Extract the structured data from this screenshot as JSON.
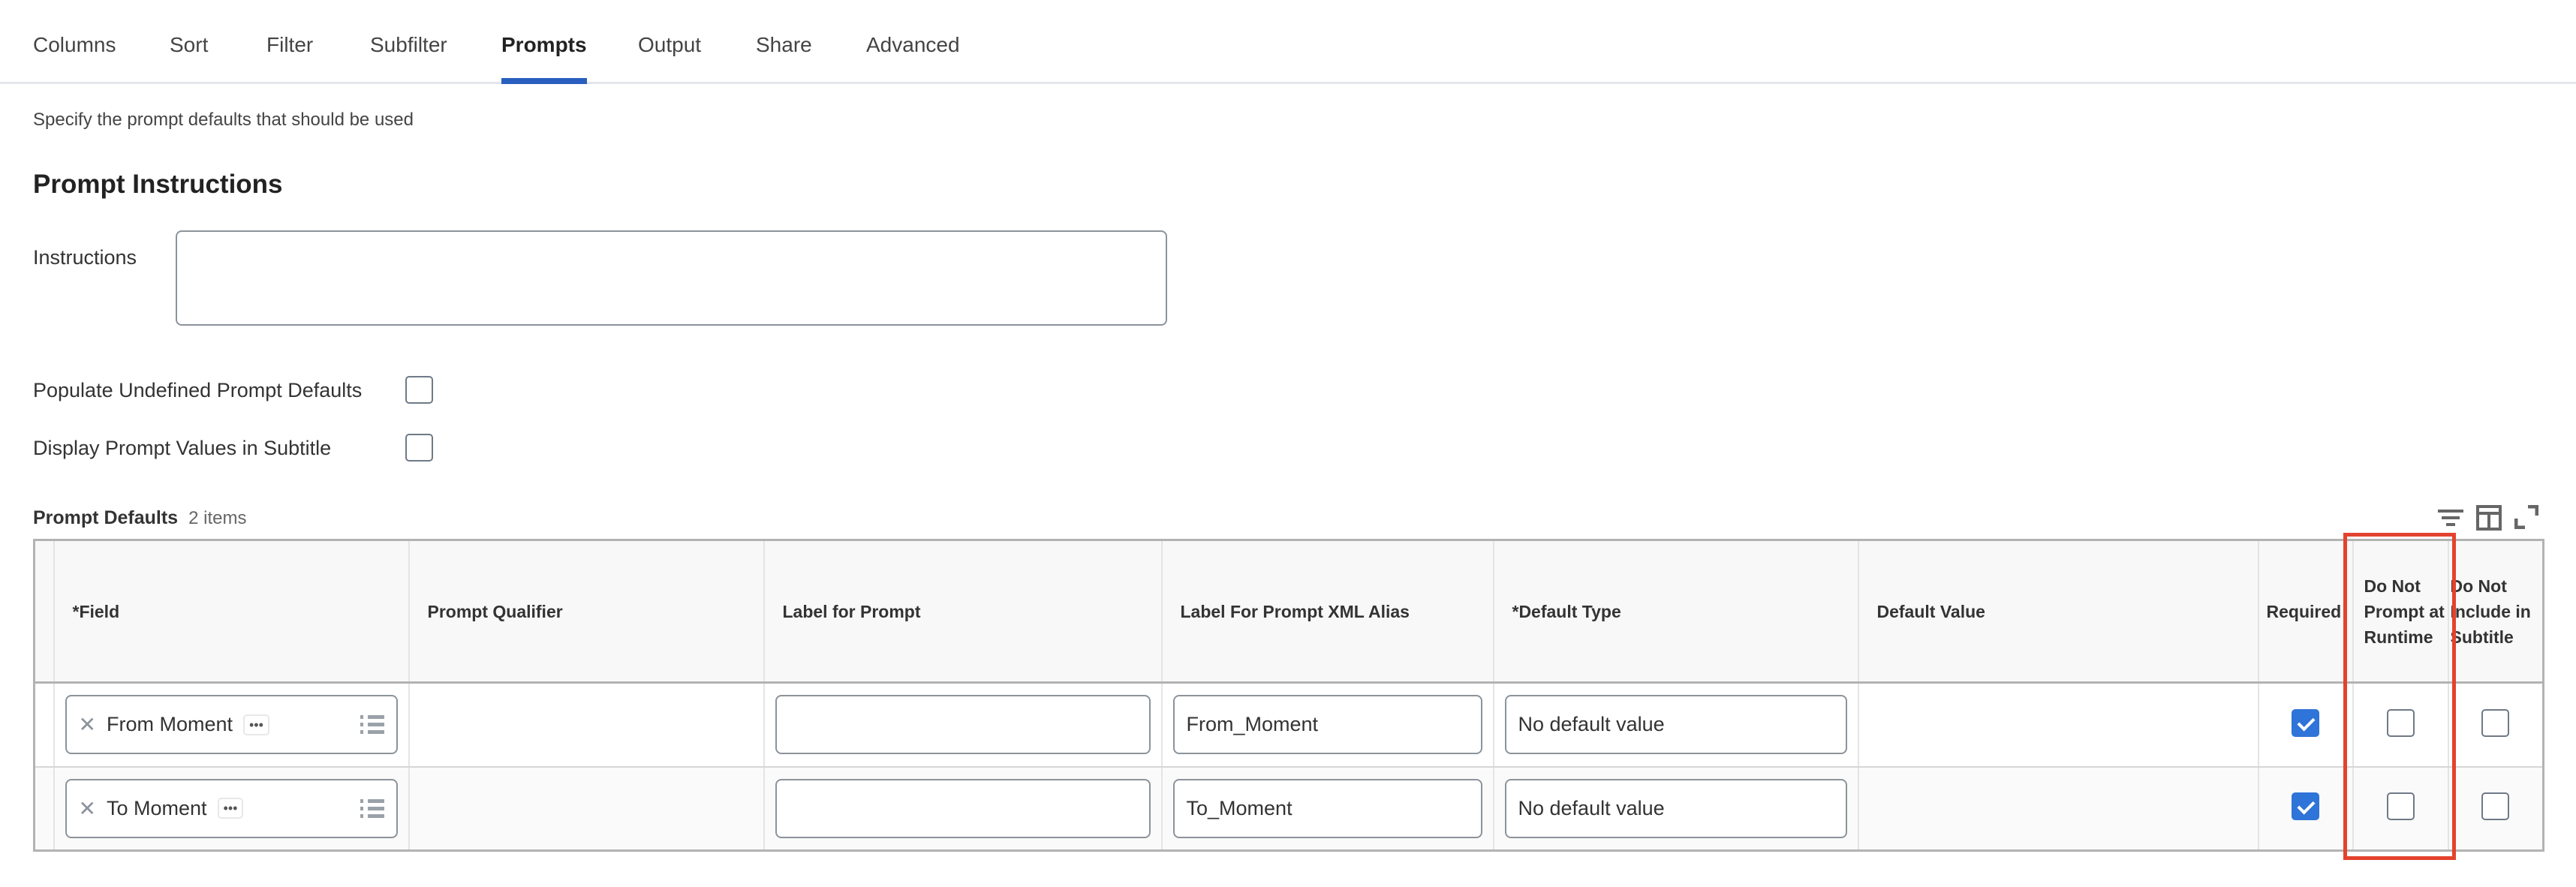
{
  "tabs": [
    "Columns",
    "Sort",
    "Filter",
    "Subfilter",
    "Prompts",
    "Output",
    "Share",
    "Advanced"
  ],
  "active_tab": "Prompts",
  "description": "Specify the prompt defaults that should be used",
  "section_title": "Prompt Instructions",
  "instructions_label": "Instructions",
  "instructions_value": "",
  "populate_label": "Populate Undefined Prompt Defaults",
  "display_label": "Display Prompt Values in Subtitle",
  "grid": {
    "title": "Prompt Defaults",
    "count": "2 items",
    "columns": [
      "*Field",
      "Prompt Qualifier",
      "Label for Prompt",
      "Label For Prompt XML Alias",
      "*Default Type",
      "Default Value",
      "Required",
      "Do Not Prompt at Runtime",
      "Do Not Include in Subtitle"
    ],
    "rows": [
      {
        "field": "From Moment",
        "qualifier": "",
        "label": "",
        "xml_alias": "From_Moment",
        "default_type": "No default value",
        "default_value": "",
        "required": true,
        "do_not_prompt": false,
        "do_not_include": false
      },
      {
        "field": "To Moment",
        "qualifier": "",
        "label": "",
        "xml_alias": "To_Moment",
        "default_type": "No default value",
        "default_value": "",
        "required": true,
        "do_not_prompt": false,
        "do_not_include": false
      }
    ]
  },
  "colors": {
    "accent": "#2a5fbf",
    "checkbox": "#2f74d8",
    "highlight": "#e4422e"
  }
}
